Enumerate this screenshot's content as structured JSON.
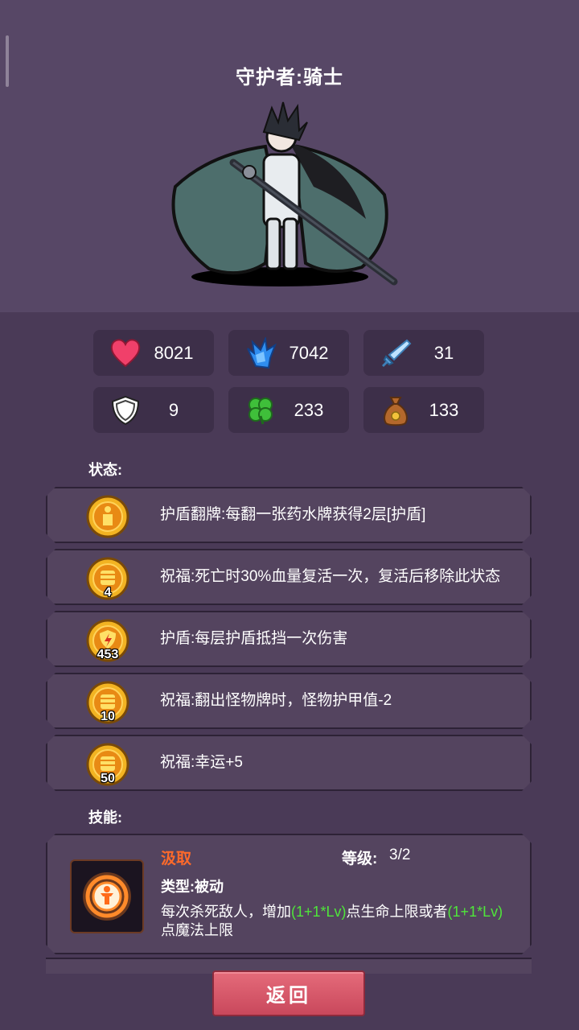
{
  "character": {
    "title": "守护者:骑士"
  },
  "stats": [
    {
      "icon": "heart-icon",
      "value": "8021"
    },
    {
      "icon": "mana-crystal-icon",
      "value": "7042"
    },
    {
      "icon": "sword-icon",
      "value": "31"
    },
    {
      "icon": "shield-icon",
      "value": "9"
    },
    {
      "icon": "clover-icon",
      "value": "233"
    },
    {
      "icon": "money-bag-icon",
      "value": "133"
    }
  ],
  "status_section": {
    "label": "状态:",
    "items": [
      {
        "icon": "shield-bearer-badge-icon",
        "count": "",
        "text": "护盾翻牌:每翻一张药水牌获得2层[护盾]"
      },
      {
        "icon": "blessing-fist-badge-icon",
        "count": "4",
        "text": "祝福:死亡时30%血量复活一次，复活后移除此状态"
      },
      {
        "icon": "shield-lightning-badge-icon",
        "count": "453",
        "text": "护盾:每层护盾抵挡一次伤害"
      },
      {
        "icon": "blessing-fist-badge-icon",
        "count": "10",
        "text": "祝福:翻出怪物牌时，怪物护甲值-2"
      },
      {
        "icon": "blessing-fist-badge-icon",
        "count": "50",
        "text": "祝福:幸运+5"
      }
    ]
  },
  "skills_section": {
    "label": "技能:",
    "skill": {
      "name": "汲取",
      "level_label": "等级:",
      "level_value": "3/2",
      "type": "类型:被动",
      "desc_part1": "每次杀死敌人，增加",
      "desc_hl1": "(1+1*Lv)",
      "desc_part2": "点生命上限或者",
      "desc_hl2": "(1+1*Lv)",
      "desc_part3": "点魔法上限"
    }
  },
  "back_button": {
    "label": "返回"
  },
  "colors": {
    "background": "#4a3a57",
    "skill_name": "#ff6a2a",
    "highlight": "#4fe63a",
    "button": "#d9576a"
  }
}
